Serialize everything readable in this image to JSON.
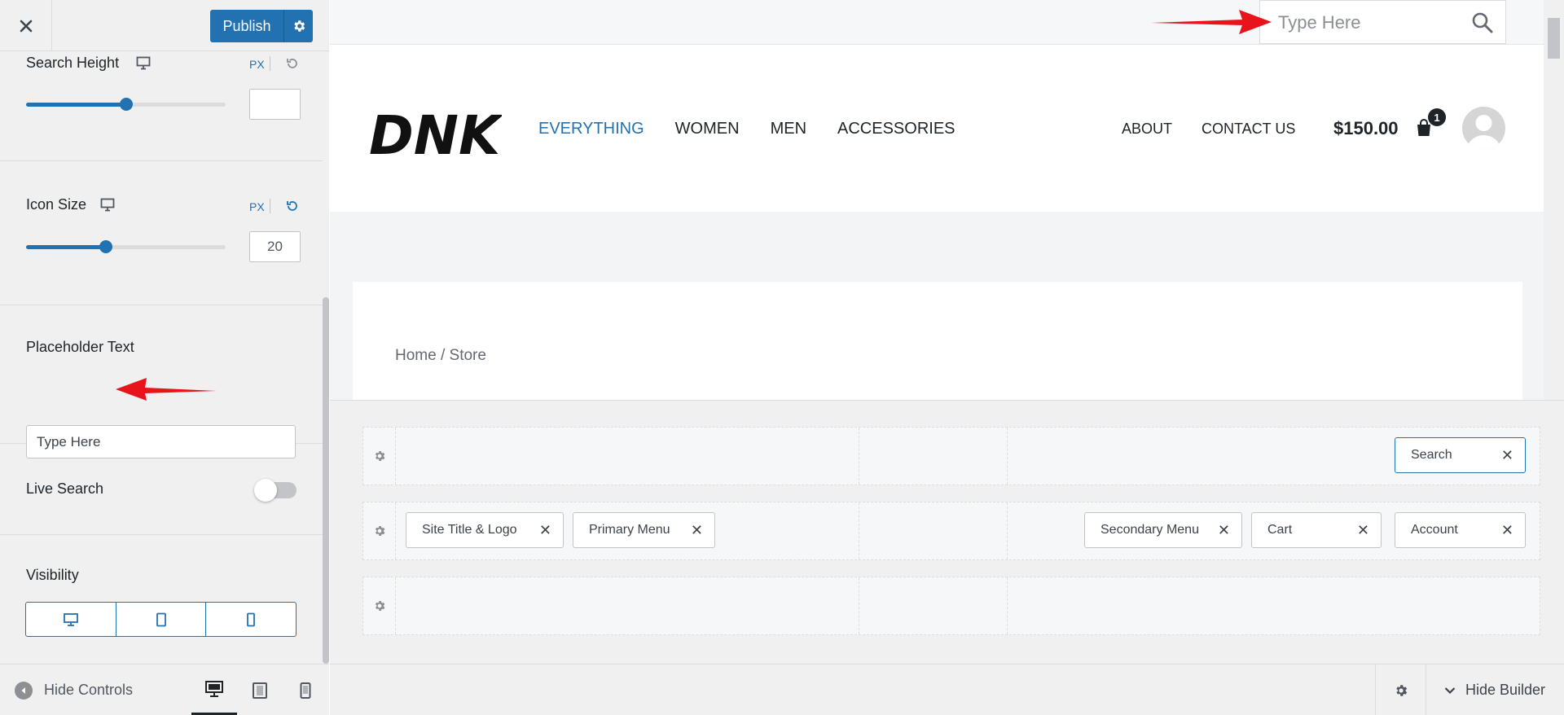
{
  "panel": {
    "publish_label": "Publish",
    "search_height": {
      "label": "Search Height",
      "unit": "PX",
      "value": "",
      "slider_percent": 50
    },
    "icon_size": {
      "label": "Icon Size",
      "unit": "PX",
      "value": "20",
      "slider_percent": 40
    },
    "placeholder": {
      "label": "Placeholder Text",
      "value": "Type Here"
    },
    "live_search": {
      "label": "Live Search",
      "enabled": false
    },
    "visibility": {
      "label": "Visibility",
      "options": [
        "desktop-icon",
        "tablet-icon",
        "mobile-icon"
      ]
    },
    "footer": {
      "hide_controls_label": "Hide Controls"
    }
  },
  "preview": {
    "search_placeholder": "Type Here",
    "logo_text": "DNK",
    "primary_menu": [
      "EVERYTHING",
      "WOMEN",
      "MEN",
      "ACCESSORIES"
    ],
    "secondary_menu": [
      "ABOUT",
      "CONTACT US"
    ],
    "cart_total": "$150.00",
    "cart_count": "1",
    "breadcrumb": "Home / Store"
  },
  "builder": {
    "rows": [
      {
        "right": [
          "Search"
        ]
      },
      {
        "left": [
          "Site Title & Logo",
          "Primary Menu"
        ],
        "right": [
          "Secondary Menu",
          "Cart",
          "Account"
        ]
      },
      {}
    ],
    "footer_label": "Hide Builder"
  },
  "colors": {
    "accent": "#2271b1",
    "arrow": "#e8141b"
  }
}
